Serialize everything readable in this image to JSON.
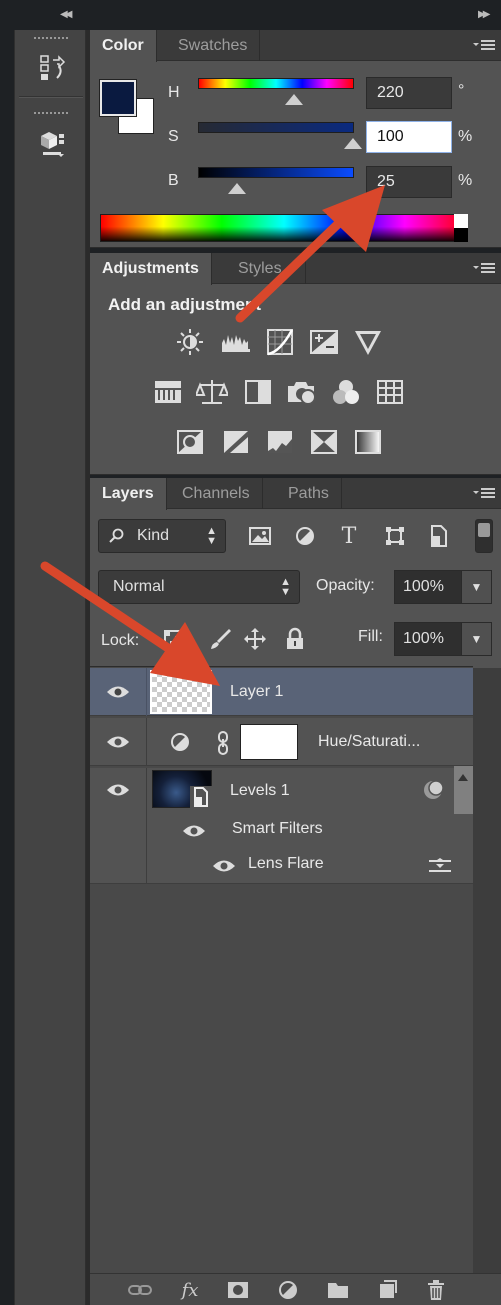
{
  "color_panel": {
    "tabs": [
      "Color",
      "Swatches"
    ],
    "foreground_color": "#0a1a40",
    "background_color": "#ffffff",
    "h": {
      "label": "H",
      "value": "220",
      "unit": "°",
      "position": 0.61
    },
    "s": {
      "label": "S",
      "value": "100",
      "unit": "%",
      "position": 1.0
    },
    "b": {
      "label": "B",
      "value": "25",
      "unit": "%",
      "position": 0.25
    }
  },
  "adjustments_panel": {
    "tabs": [
      "Adjustments",
      "Styles"
    ],
    "title": "Add an adjustment",
    "icons": [
      [
        "brightness-contrast-icon",
        "levels-icon",
        "curves-icon",
        "exposure-icon",
        "vibrance-icon"
      ],
      [
        "hue-saturation-icon",
        "color-balance-icon",
        "black-white-icon",
        "photo-filter-icon",
        "channel-mixer-icon",
        "color-lookup-icon"
      ],
      [
        "invert-icon",
        "posterize-icon",
        "threshold-icon",
        "selective-color-icon",
        "gradient-map-icon"
      ]
    ]
  },
  "layers_panel": {
    "tabs": [
      "Layers",
      "Channels",
      "Paths"
    ],
    "filter_kind": "Kind",
    "blend_mode": "Normal",
    "opacity_label": "Opacity:",
    "opacity_value": "100%",
    "lock_label": "Lock:",
    "fill_label": "Fill:",
    "fill_value": "100%",
    "layers": [
      {
        "name": "Layer 1",
        "selected": true
      },
      {
        "name": "Hue/Saturati...",
        "selected": false
      },
      {
        "name": "Levels 1",
        "selected": false
      }
    ],
    "smart_filters_label": "Smart Filters",
    "lens_flare_label": "Lens Flare"
  },
  "annotation_color": "#d9472b"
}
